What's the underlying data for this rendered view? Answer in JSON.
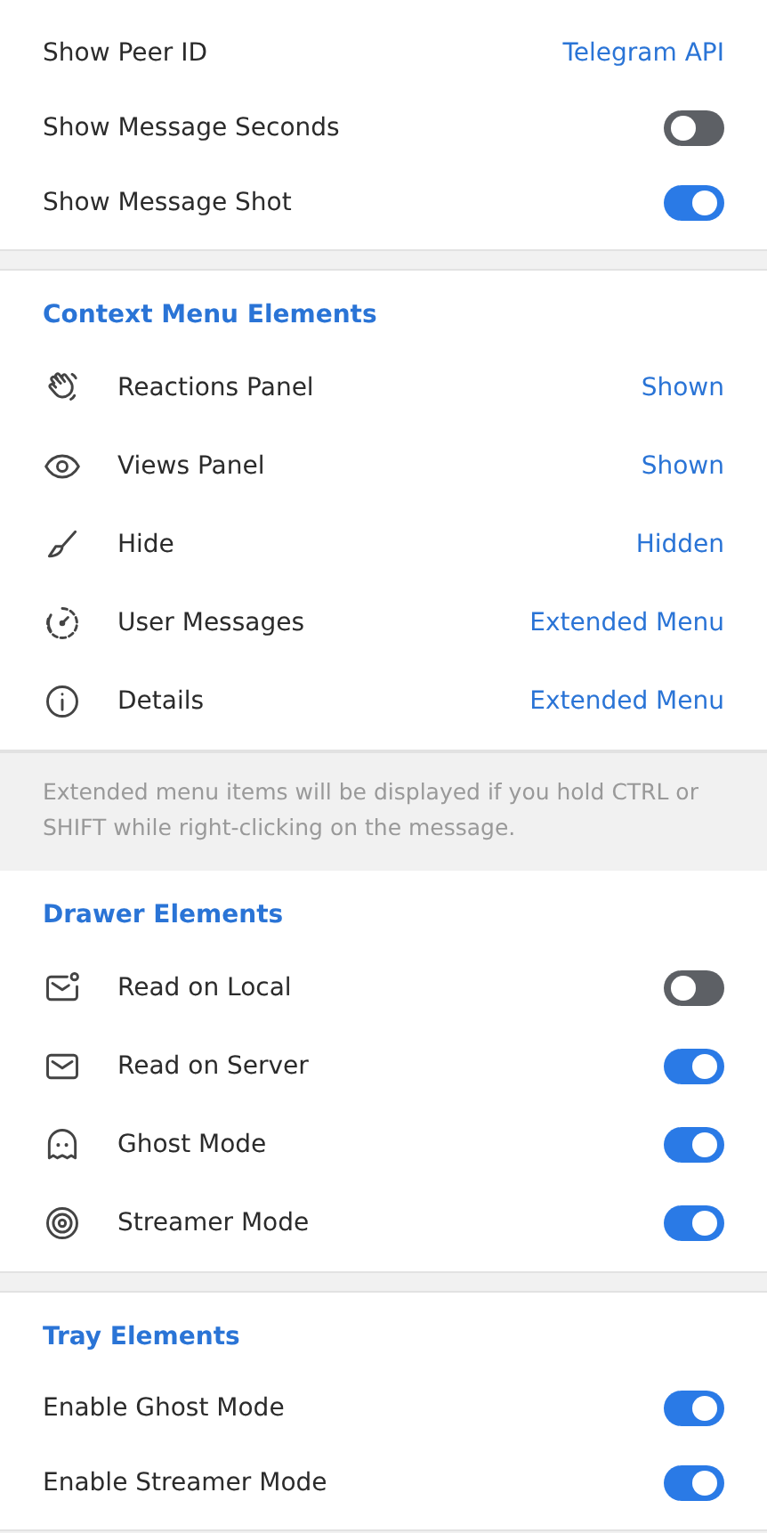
{
  "sections": [
    {
      "rows": [
        {
          "kind": "value",
          "label": "Show Peer ID",
          "value": "Telegram API"
        },
        {
          "kind": "toggle",
          "label": "Show Message Seconds",
          "on": false
        },
        {
          "kind": "toggle",
          "label": "Show Message Shot",
          "on": true
        }
      ]
    },
    {
      "title": "Context Menu Elements",
      "rows": [
        {
          "kind": "value",
          "label": "Reactions Panel",
          "value": "Shown"
        },
        {
          "kind": "value",
          "label": "Views Panel",
          "value": "Shown"
        },
        {
          "kind": "value",
          "label": "Hide",
          "value": "Hidden"
        },
        {
          "kind": "value",
          "label": "User Messages",
          "value": "Extended Menu"
        },
        {
          "kind": "value",
          "label": "Details",
          "value": "Extended Menu"
        }
      ],
      "note": "Extended menu items will be displayed if you hold CTRL or SHIFT while right-clicking on the message."
    },
    {
      "title": "Drawer Elements",
      "rows": [
        {
          "kind": "toggle",
          "label": "Read on Local",
          "on": false
        },
        {
          "kind": "toggle",
          "label": "Read on Server",
          "on": true
        },
        {
          "kind": "toggle",
          "label": "Ghost Mode",
          "on": true
        },
        {
          "kind": "toggle",
          "label": "Streamer Mode",
          "on": true
        }
      ]
    },
    {
      "title": "Tray Elements",
      "rows": [
        {
          "kind": "toggle",
          "label": "Enable Ghost Mode",
          "on": true
        },
        {
          "kind": "toggle",
          "label": "Enable Streamer Mode",
          "on": true
        }
      ]
    }
  ]
}
